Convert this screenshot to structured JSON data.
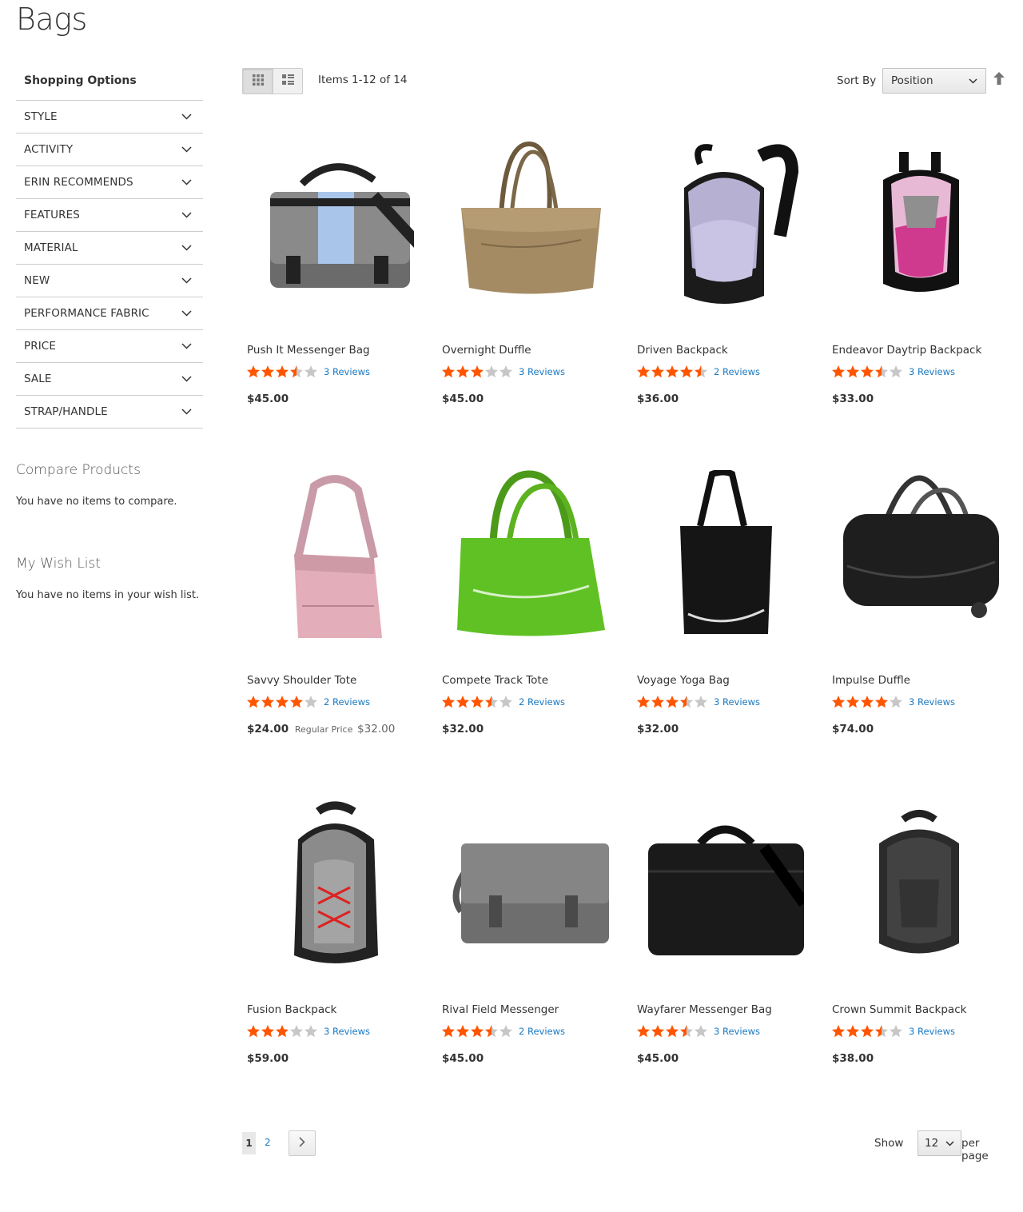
{
  "page": {
    "title": "Bags"
  },
  "sidebar": {
    "heading": "Shopping Options",
    "filters": [
      "STYLE",
      "ACTIVITY",
      "ERIN RECOMMENDS",
      "FEATURES",
      "MATERIAL",
      "NEW",
      "PERFORMANCE FABRIC",
      "PRICE",
      "SALE",
      "STRAP/HANDLE"
    ],
    "compare": {
      "title": "Compare Products",
      "text": "You have no items to compare."
    },
    "wishlist": {
      "title": "My Wish List",
      "text": "You have no items in your wish list."
    }
  },
  "toolbar": {
    "view_modes": [
      "grid-icon",
      "list-icon"
    ],
    "active_mode": "grid",
    "amount": "Items 1-12 of 14",
    "sort_label": "Sort By",
    "sort_value": "Position"
  },
  "products": [
    {
      "name": "Push It Messenger Bag",
      "rating": 3.5,
      "reviews": "3 Reviews",
      "price": "$45.00",
      "image": "messenger-bag-grey-blue"
    },
    {
      "name": "Overnight Duffle",
      "rating": 3,
      "reviews": "3 Reviews",
      "price": "$45.00",
      "image": "duffle-tan"
    },
    {
      "name": "Driven Backpack",
      "rating": 4.5,
      "reviews": "2 Reviews",
      "price": "$36.00",
      "image": "backpack-lavender"
    },
    {
      "name": "Endeavor Daytrip Backpack",
      "rating": 3.5,
      "reviews": "3 Reviews",
      "price": "$33.00",
      "image": "backpack-pink"
    },
    {
      "name": "Savvy Shoulder Tote",
      "rating": 4,
      "reviews": "2 Reviews",
      "price": "$24.00",
      "regular_label": "Regular Price",
      "regular_price": "$32.00",
      "image": "tote-pink"
    },
    {
      "name": "Compete Track Tote",
      "rating": 3.5,
      "reviews": "2 Reviews",
      "price": "$32.00",
      "image": "tote-green"
    },
    {
      "name": "Voyage Yoga Bag",
      "rating": 3.5,
      "reviews": "3 Reviews",
      "price": "$32.00",
      "image": "yoga-bag-black"
    },
    {
      "name": "Impulse Duffle",
      "rating": 4,
      "reviews": "3 Reviews",
      "price": "$74.00",
      "image": "rolling-duffle-black"
    },
    {
      "name": "Fusion Backpack",
      "rating": 3,
      "reviews": "3 Reviews",
      "price": "$59.00",
      "image": "backpack-grey-red"
    },
    {
      "name": "Rival Field Messenger",
      "rating": 3.5,
      "reviews": "2 Reviews",
      "price": "$45.00",
      "image": "messenger-grey"
    },
    {
      "name": "Wayfarer Messenger Bag",
      "rating": 3.5,
      "reviews": "3 Reviews",
      "price": "$45.00",
      "image": "messenger-black"
    },
    {
      "name": "Crown Summit Backpack",
      "rating": 3.5,
      "reviews": "3 Reviews",
      "price": "$38.00",
      "image": "backpack-dark-grey"
    }
  ],
  "pager": {
    "current_page": "1",
    "pages": [
      "2"
    ],
    "limit_label": "Show",
    "limit_value": "12",
    "per_page_label": "per page"
  },
  "colors": {
    "star": "#ff5501",
    "star_empty": "#c7c7c7",
    "link": "#1979c3"
  }
}
